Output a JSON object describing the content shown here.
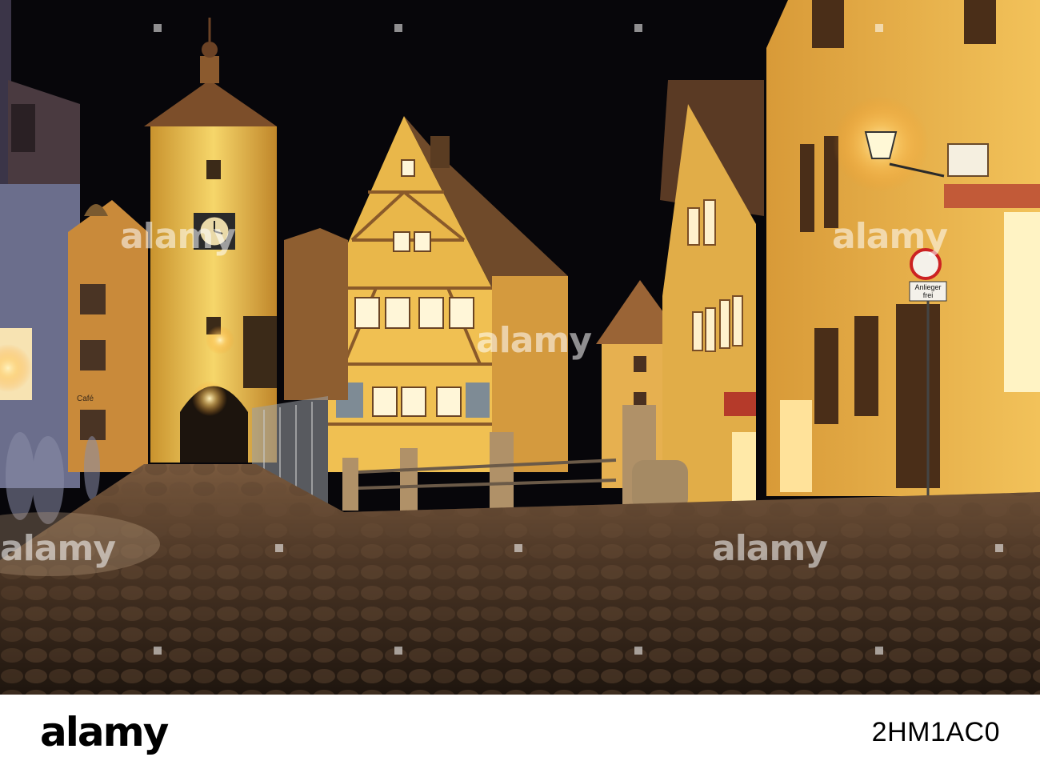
{
  "scene": {
    "sky_color": "#07060a",
    "lamp_color": "#ffd27a",
    "wall_color": "#e7b13c",
    "cobble_color": "#4a3525"
  },
  "signs": {
    "shop_sign": "Café",
    "street_sign_line1": "Anlieger",
    "street_sign_line2": "frei"
  },
  "watermark": {
    "text": "alamy"
  },
  "footer": {
    "brand": "alamy",
    "image_id": "2HM1AC0"
  }
}
